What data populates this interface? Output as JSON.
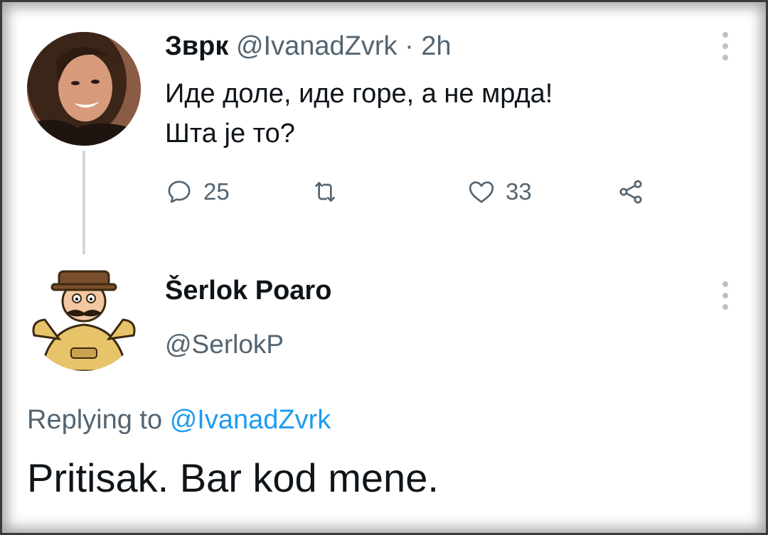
{
  "tweet": {
    "author_name": "Зврк",
    "author_handle": "@IvanadZvrk",
    "separator": "·",
    "time": "2h",
    "text_line1": "Иде доле, иде горе, а не мрда!",
    "text_line2": "Шта је то?",
    "reply_count": "25",
    "like_count": "33"
  },
  "reply": {
    "author_name": "Šerlok Poaro",
    "author_handle": "@SerlokP",
    "replying_prefix": "Replying to",
    "replying_to": "@IvanadZvrk",
    "text": "Pritisak. Bar kod mene."
  },
  "icons": {
    "reply": "speech-bubble-icon",
    "retweet": "retweet-icon",
    "like": "heart-icon",
    "share": "share-icon",
    "more": "more-vertical-icon"
  },
  "colors": {
    "text": "#0f1419",
    "muted": "#536471",
    "link": "#1d9bf0",
    "thread_line": "#cfd9de"
  }
}
